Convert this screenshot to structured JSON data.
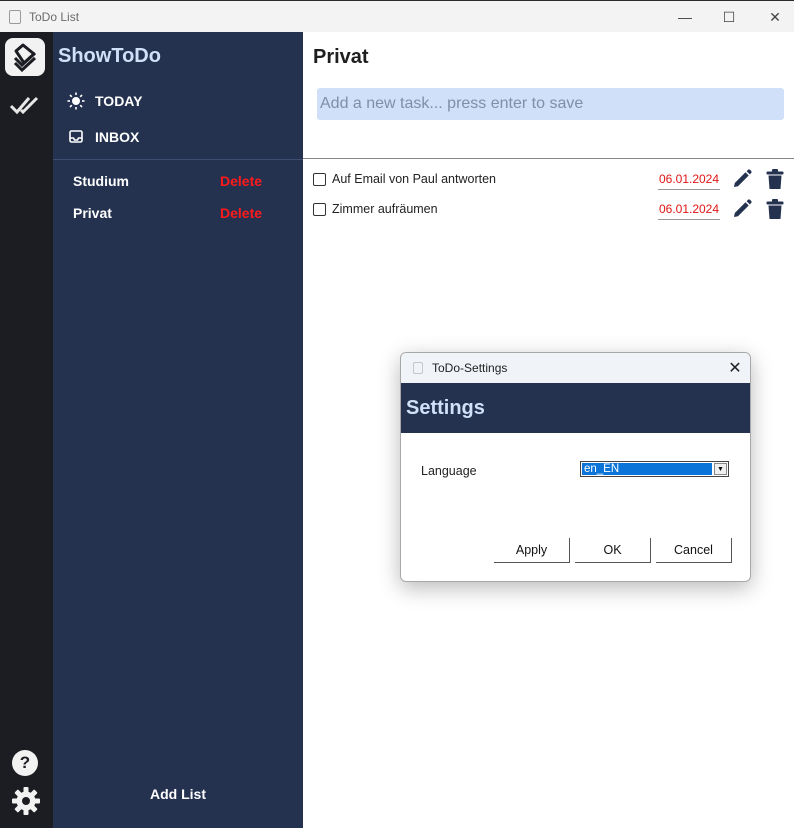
{
  "window": {
    "title": "ToDo List",
    "min_glyph": "—",
    "max_glyph": "☐",
    "close_glyph": "✕"
  },
  "rail": {
    "help_glyph": "?"
  },
  "sidebar": {
    "brand": "ShowToDo",
    "nav": [
      {
        "label": "TODAY",
        "icon": "sun-icon"
      },
      {
        "label": "INBOX",
        "icon": "inbox-icon"
      }
    ],
    "lists": [
      {
        "name": "Studium",
        "delete_label": "Delete"
      },
      {
        "name": "Privat",
        "delete_label": "Delete"
      }
    ],
    "add_list_label": "Add List"
  },
  "main": {
    "heading": "Privat",
    "new_task_placeholder": "Add a new task... press enter to save",
    "tasks": [
      {
        "text": "Auf Email von Paul antworten",
        "date": "06.01.2024",
        "done": false
      },
      {
        "text": "Zimmer aufräumen",
        "date": "06.01.2024",
        "done": false
      }
    ]
  },
  "dialog": {
    "title": "ToDo-Settings",
    "close_glyph": "✕",
    "header": "Settings",
    "language_label": "Language",
    "language_value": "en_EN",
    "buttons": {
      "apply": "Apply",
      "ok": "OK",
      "cancel": "Cancel"
    }
  },
  "colors": {
    "rail": "#1c1d22",
    "sidebar": "#243250",
    "brand_text": "#cfe0f7",
    "delete": "#ff1a1a",
    "date": "#e01515",
    "input_bg": "#cfe0f8",
    "select_highlight": "#0a74d8"
  }
}
